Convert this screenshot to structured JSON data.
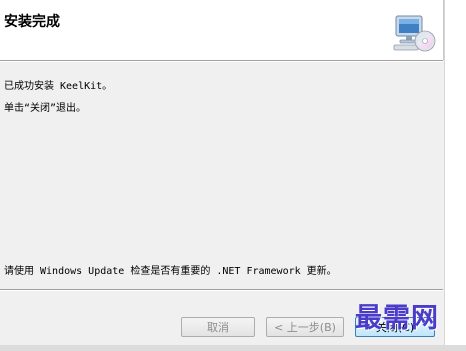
{
  "header": {
    "title": "安装完成",
    "icon": "computer-cd-icon"
  },
  "messages": {
    "installed": "已成功安装 KeelKit。",
    "exit_hint": "单击“关闭”退出。",
    "update_hint": "请使用 Windows Update 检查是否有重要的 .NET Framework 更新。"
  },
  "buttons": {
    "cancel": "取消",
    "back": "< 上一步(B)",
    "close": "关闭(C)"
  },
  "watermark": "最需网",
  "colors": {
    "watermark": "#4a3cc8",
    "close_button_border": "#3c7fb1"
  }
}
